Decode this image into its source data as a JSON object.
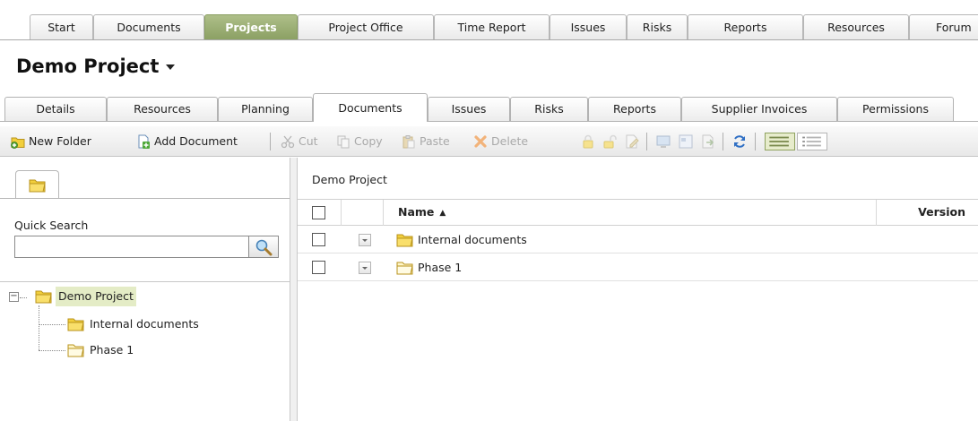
{
  "top_nav": {
    "tabs": [
      "Start",
      "Documents",
      "Projects",
      "Project Office",
      "Time Report",
      "Issues",
      "Risks",
      "Reports",
      "Resources",
      "Forum"
    ],
    "active": "Projects"
  },
  "project": {
    "title": "Demo Project"
  },
  "sub_tabs": {
    "tabs": [
      "Details",
      "Resources",
      "Planning",
      "Documents",
      "Issues",
      "Risks",
      "Reports",
      "Supplier Invoices",
      "Permissions"
    ],
    "active": "Documents"
  },
  "toolbar": {
    "new_folder": "New Folder",
    "add_document": "Add Document",
    "cut": "Cut",
    "copy": "Copy",
    "paste": "Paste",
    "delete": "Delete"
  },
  "left_panel": {
    "quick_search_label": "Quick Search",
    "quick_search_value": "",
    "tree": {
      "root": "Demo Project",
      "children": [
        "Internal documents",
        "Phase 1"
      ]
    }
  },
  "main": {
    "breadcrumb": "Demo Project",
    "columns": {
      "name": "Name",
      "version": "Version"
    },
    "sort_indicator": "▲",
    "rows": [
      {
        "name": "Internal documents"
      },
      {
        "name": "Phase 1"
      }
    ]
  },
  "colors": {
    "active_tab": "#9aad72",
    "tree_selection": "#e4ecc6",
    "folder": "#f2cf3c"
  }
}
